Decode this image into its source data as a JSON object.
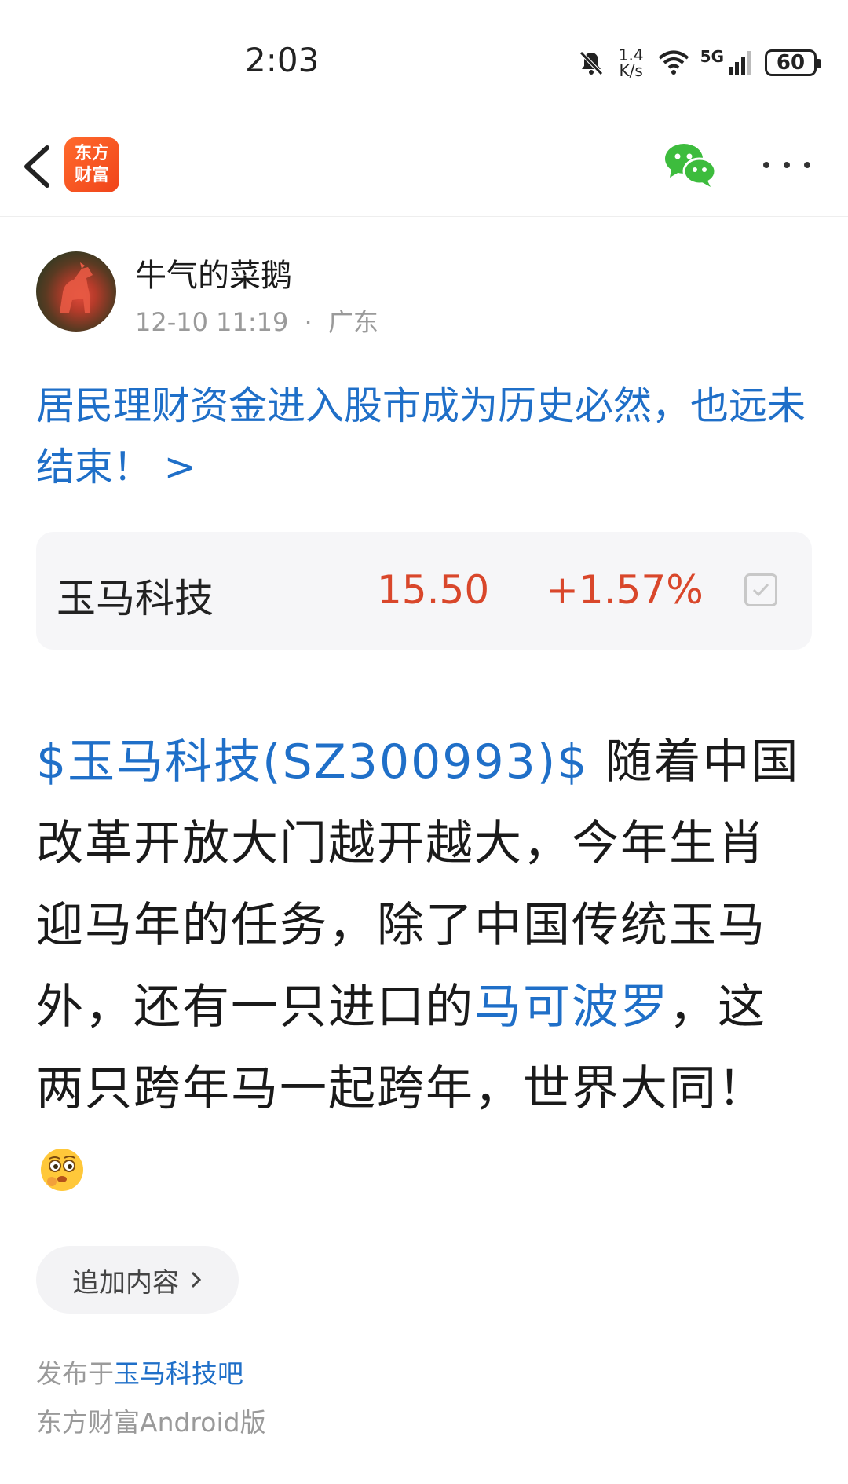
{
  "status_bar": {
    "time": "2:03",
    "net_speed_value": "1.4",
    "net_speed_unit": "K/s",
    "network": "5G",
    "battery": "60"
  },
  "nav": {
    "logo_line1": "东方",
    "logo_line2": "财富",
    "logo_color": "#f0441a",
    "share_icon": "wechat-icon",
    "more_icon": "more-icon"
  },
  "author": {
    "name": "牛气的菜鹅",
    "datetime": "12-10 11:19",
    "separator": "·",
    "location": "广东"
  },
  "headline": {
    "text": "居民理财资金进入股市成为历史必然，也远未结束！",
    "arrow": ">"
  },
  "stock_card": {
    "name": "玉马科技",
    "price": "15.50",
    "change": "+1.57%",
    "up_color": "#d9472b"
  },
  "post": {
    "stock_link": "$玉马科技(SZ300993)$",
    "text1": " 随着中国改革开放大门越开越大，今年生肖迎马年的任务，除了中国传统玉马外，还有一只进口的",
    "topic_link": "马可波罗",
    "text2": "，这两只跨年马一起跨年，世界大同！",
    "emoji": "thinking-face-emoji"
  },
  "append_button": {
    "label": "追加内容"
  },
  "footer": {
    "published_prefix": "发布于",
    "forum_link": "玉马科技吧",
    "client": "东方财富Android版"
  },
  "colors": {
    "link": "#1f6fc8",
    "card_bg": "#f6f6f8"
  }
}
